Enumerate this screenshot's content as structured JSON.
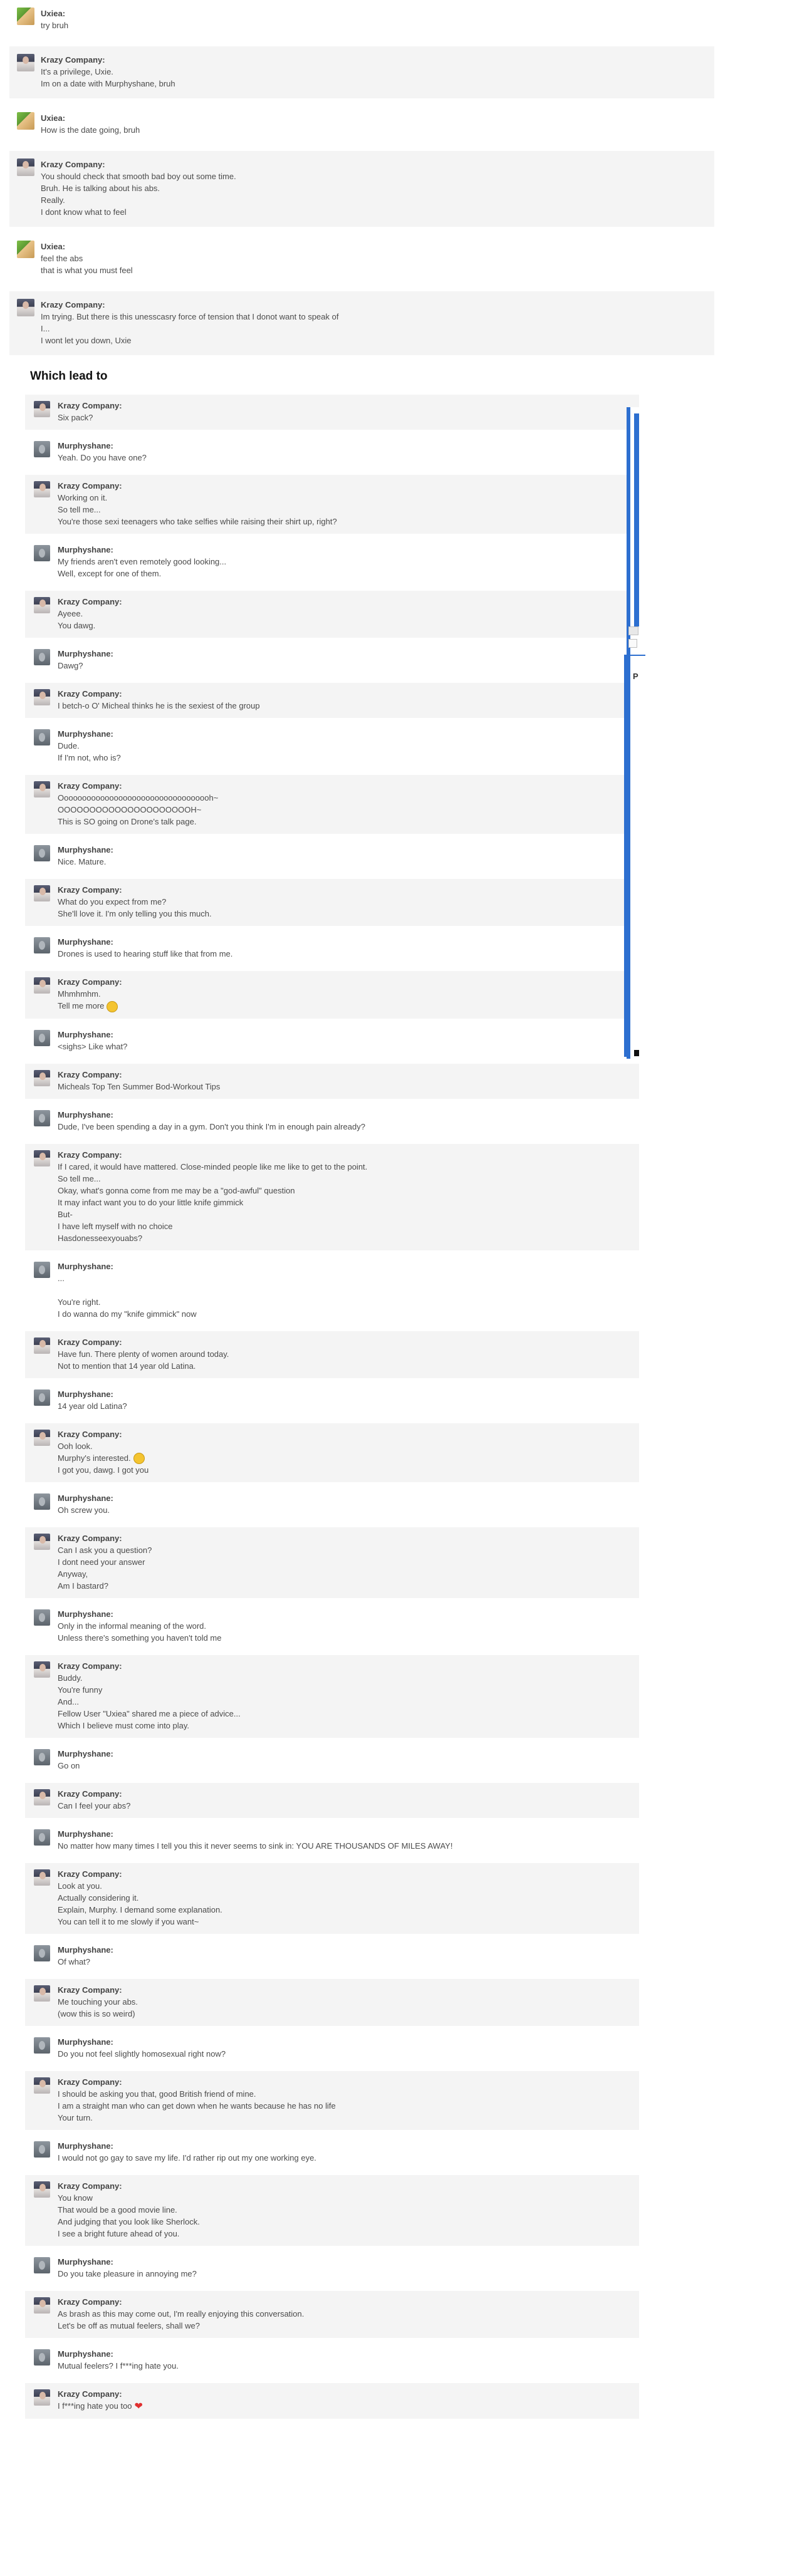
{
  "top_chat": [
    {
      "author": "Uxiea",
      "avatar": "uxiea",
      "lines": [
        "try bruh"
      ],
      "bg": "white"
    },
    {
      "author": "Krazy Company",
      "avatar": "krazy",
      "lines": [
        "It's a privilege, Uxie.",
        "Im on a date with Murphyshane, bruh"
      ],
      "bg": "grey"
    },
    {
      "author": "Uxiea",
      "avatar": "uxiea",
      "lines": [
        "How is the date going, bruh"
      ],
      "bg": "white"
    },
    {
      "author": "Krazy Company",
      "avatar": "krazy",
      "lines": [
        "You should check that smooth bad boy out some time.",
        "Bruh. He is talking about his abs.",
        "Really.",
        "I dont know what to feel"
      ],
      "bg": "grey"
    },
    {
      "author": "Uxiea",
      "avatar": "uxiea",
      "lines": [
        "feel the abs",
        "that is what you must feel"
      ],
      "bg": "white"
    },
    {
      "author": "Krazy Company",
      "avatar": "krazy",
      "lines": [
        "Im trying. But there is this unesscasry force of tension that I donot want to speak of",
        "I...",
        "I wont let you down, Uxie"
      ],
      "bg": "grey"
    }
  ],
  "heading": "Which lead to",
  "second_chat": [
    {
      "author": "Krazy Company",
      "avatar": "krazy",
      "lines": [
        "Six pack?"
      ],
      "bg": "grey"
    },
    {
      "author": "Murphyshane",
      "avatar": "murphy",
      "lines": [
        "Yeah. Do you have one?"
      ],
      "bg": "white"
    },
    {
      "author": "Krazy Company",
      "avatar": "krazy",
      "lines": [
        "Working on it.",
        "So tell me...",
        "You're those sexi teenagers who take selfies while raising their shirt up, right?"
      ],
      "bg": "grey"
    },
    {
      "author": "Murphyshane",
      "avatar": "murphy",
      "lines": [
        "My friends aren't even remotely good looking...",
        "Well, except for one of them."
      ],
      "bg": "white"
    },
    {
      "author": "Krazy Company",
      "avatar": "krazy",
      "lines": [
        "Ayeee.",
        "You dawg."
      ],
      "bg": "grey"
    },
    {
      "author": "Murphyshane",
      "avatar": "murphy",
      "lines": [
        "Dawg?"
      ],
      "bg": "white"
    },
    {
      "author": "Krazy Company",
      "avatar": "krazy",
      "lines": [
        "I betch-o O' Micheal thinks he is the sexiest of the group"
      ],
      "bg": "grey"
    },
    {
      "author": "Murphyshane",
      "avatar": "murphy",
      "lines": [
        "Dude.",
        "If I'm not, who is?"
      ],
      "bg": "white"
    },
    {
      "author": "Krazy Company",
      "avatar": "krazy",
      "lines": [
        "Oooooooooooooooooooooooooooooooooh~",
        "OOOOOOOOOOOOOOOOOOOOOH~",
        "This is SO going on Drone's talk page."
      ],
      "bg": "grey"
    },
    {
      "author": "Murphyshane",
      "avatar": "murphy",
      "lines": [
        "Nice. Mature."
      ],
      "bg": "white"
    },
    {
      "author": "Krazy Company",
      "avatar": "krazy",
      "lines": [
        "What do you expect from me?",
        "She'll love it. I'm only telling you this much."
      ],
      "bg": "grey"
    },
    {
      "author": "Murphyshane",
      "avatar": "murphy",
      "lines": [
        "Drones is used to hearing stuff like that from me."
      ],
      "bg": "white"
    },
    {
      "author": "Krazy Company",
      "avatar": "krazy",
      "lines": [
        "Mhmhmhm.",
        "Tell me more"
      ],
      "emote_last": "grin",
      "bg": "grey"
    },
    {
      "author": "Murphyshane",
      "avatar": "murphy",
      "lines": [
        "<sighs> Like what?"
      ],
      "bg": "white"
    },
    {
      "author": "Krazy Company",
      "avatar": "krazy",
      "lines": [
        "Micheals Top Ten Summer Bod-Workout Tips"
      ],
      "bg": "grey"
    },
    {
      "author": "Murphyshane",
      "avatar": "murphy",
      "lines": [
        "Dude, I've been spending a day in a gym. Don't you think I'm in enough pain already?"
      ],
      "bg": "white"
    },
    {
      "author": "Krazy Company",
      "avatar": "krazy",
      "lines": [
        "If I cared, it would have mattered. Close-minded people like me like to get to the point.",
        "So tell me...",
        "Okay, what's gonna come from me may be a \"god-awful\" question",
        "It may infact want you to do your little knife gimmick",
        "But-",
        "I have left myself with no choice",
        "Hasdonesseexyouabs?"
      ],
      "bg": "grey"
    },
    {
      "author": "Murphyshane",
      "avatar": "murphy",
      "lines": [
        "...",
        "",
        "You're right.",
        "I do wanna do my \"knife gimmick\" now"
      ],
      "bg": "white"
    },
    {
      "author": "Krazy Company",
      "avatar": "krazy",
      "lines": [
        "Have fun. There plenty of women around today.",
        "Not to mention that 14 year old Latina."
      ],
      "bg": "grey"
    },
    {
      "author": "Murphyshane",
      "avatar": "murphy",
      "lines": [
        "14 year old Latina?"
      ],
      "bg": "white"
    },
    {
      "author": "Krazy Company",
      "avatar": "krazy",
      "lines": [
        "Ooh look.",
        "Murphy's interested.",
        "I got you, dawg. I got you"
      ],
      "emote_line": 1,
      "bg": "grey"
    },
    {
      "author": "Murphyshane",
      "avatar": "murphy",
      "lines": [
        "Oh screw you."
      ],
      "bg": "white"
    },
    {
      "author": "Krazy Company",
      "avatar": "krazy",
      "lines": [
        "Can I ask you a question?",
        "I dont need your answer",
        "Anyway,",
        "Am I bastard?"
      ],
      "bg": "grey"
    },
    {
      "author": "Murphyshane",
      "avatar": "murphy",
      "lines": [
        "Only in the informal meaning of the word.",
        "Unless there's something you haven't told me"
      ],
      "bg": "white"
    },
    {
      "author": "Krazy Company",
      "avatar": "krazy",
      "lines": [
        "Buddy.",
        "You're funny",
        "And...",
        "Fellow User \"Uxiea\" shared me a piece of advice...",
        "Which I believe must come into play."
      ],
      "bg": "grey"
    },
    {
      "author": "Murphyshane",
      "avatar": "murphy",
      "lines": [
        "Go on"
      ],
      "bg": "white"
    },
    {
      "author": "Krazy Company",
      "avatar": "krazy",
      "lines": [
        "Can I feel your abs?"
      ],
      "bg": "grey"
    },
    {
      "author": "Murphyshane",
      "avatar": "murphy",
      "lines": [
        "No matter how many times I tell you this it never seems to sink in: YOU ARE THOUSANDS OF MILES AWAY!"
      ],
      "bg": "white"
    },
    {
      "author": "Krazy Company",
      "avatar": "krazy",
      "lines": [
        "Look at you.",
        "Actually considering it.",
        "Explain, Murphy. I demand some explanation.",
        "You can tell it to me slowly if you want~"
      ],
      "bg": "grey"
    },
    {
      "author": "Murphyshane",
      "avatar": "murphy",
      "lines": [
        "Of what?"
      ],
      "bg": "white"
    },
    {
      "author": "Krazy Company",
      "avatar": "krazy",
      "lines": [
        "Me touching your abs.",
        "(wow this is so weird)"
      ],
      "bg": "grey"
    },
    {
      "author": "Murphyshane",
      "avatar": "murphy",
      "lines": [
        "Do you not feel slightly homosexual right now?"
      ],
      "bg": "white"
    },
    {
      "author": "Krazy Company",
      "avatar": "krazy",
      "lines": [
        "I should be asking you that, good British friend of mine.",
        "I am a straight man who can get down when he wants because he has no life",
        "Your turn."
      ],
      "bg": "grey"
    },
    {
      "author": "Murphyshane",
      "avatar": "murphy",
      "lines": [
        "I would not go gay to save my life. I'd rather rip out my one working eye."
      ],
      "bg": "white"
    },
    {
      "author": "Krazy Company",
      "avatar": "krazy",
      "lines": [
        "You know",
        "That would be a good movie line.",
        "And judging that you look like Sherlock.",
        "I see a bright future ahead of you."
      ],
      "bg": "grey"
    },
    {
      "author": "Murphyshane",
      "avatar": "murphy",
      "lines": [
        "Do you take pleasure in annoying me?"
      ],
      "bg": "white"
    },
    {
      "author": "Krazy Company",
      "avatar": "krazy",
      "lines": [
        "As brash as this may come out, I'm really enjoying this conversation.",
        "Let's be off as mutual feelers, shall we?"
      ],
      "bg": "grey"
    },
    {
      "author": "Murphyshane",
      "avatar": "murphy",
      "lines": [
        "Mutual feelers? I f***ing hate you."
      ],
      "bg": "white"
    },
    {
      "author": "Krazy Company",
      "avatar": "krazy",
      "lines": [
        "I f***ing hate you too"
      ],
      "emote_last": "heart",
      "bg": "grey"
    }
  ],
  "sidebar": {
    "label": "P"
  }
}
